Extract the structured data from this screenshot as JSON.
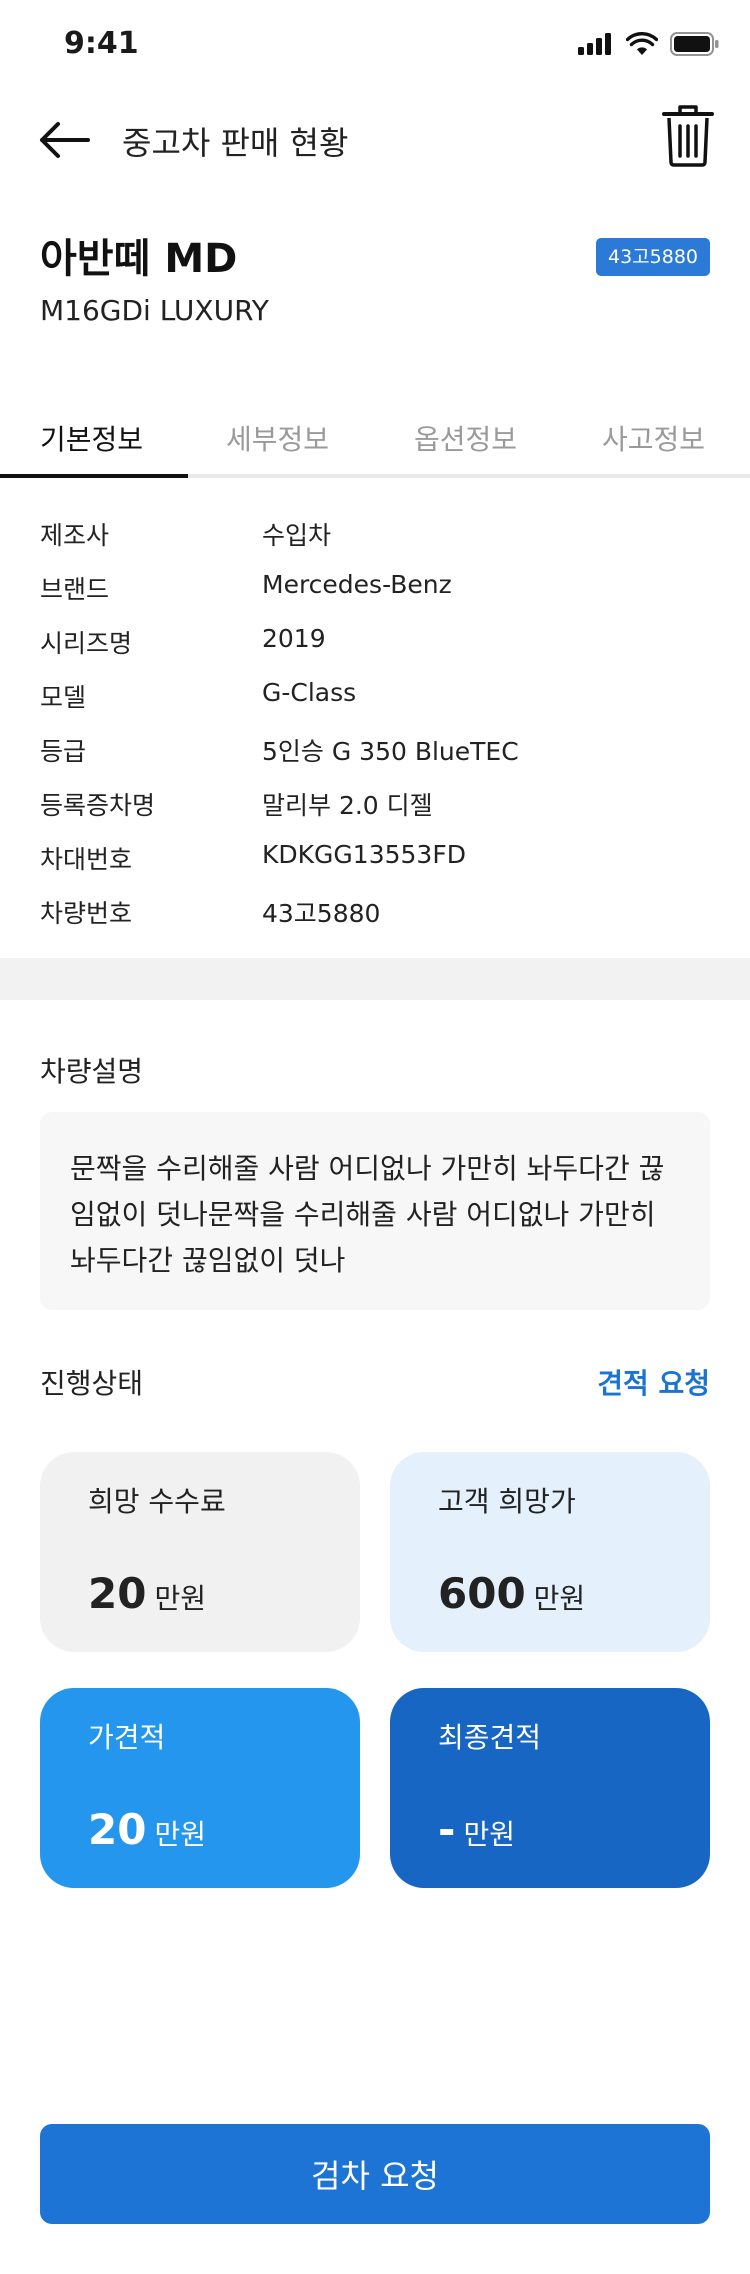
{
  "status": {
    "time": "9:41"
  },
  "header": {
    "title": "중고차 판매 현황"
  },
  "car": {
    "name": "아반떼 MD",
    "trim": "M16GDi LUXURY",
    "plate": "43고5880"
  },
  "tabs": [
    {
      "label": "기본정보",
      "active": true
    },
    {
      "label": "세부정보",
      "active": false
    },
    {
      "label": "옵션정보",
      "active": false
    },
    {
      "label": "사고정보",
      "active": false
    }
  ],
  "info": [
    {
      "key": "제조사",
      "value": "수입차"
    },
    {
      "key": "브랜드",
      "value": "Mercedes-Benz"
    },
    {
      "key": "시리즈명",
      "value": "2019"
    },
    {
      "key": "모델",
      "value": "G-Class"
    },
    {
      "key": "등급",
      "value": "5인승 G 350 BlueTEC"
    },
    {
      "key": "등록증차명",
      "value": "말리부 2.0 디젤"
    },
    {
      "key": "차대번호",
      "value": "KDKGG13553FD"
    },
    {
      "key": "차량번호",
      "value": "43고5880"
    }
  ],
  "description": {
    "label": "차량설명",
    "text": "문짝을 수리해줄 사람 어디없나 가만히 놔두다간 끊임없이 덧나문짝을 수리해줄 사람 어디없나 가만히 놔두다간 끊임없이 덧나"
  },
  "progress": {
    "label": "진행상태",
    "estimate_link": "견적 요청",
    "cards": {
      "fee": {
        "label": "희망 수수료",
        "amount": "20",
        "unit": "만원"
      },
      "hope": {
        "label": "고객 희망가",
        "amount": "600",
        "unit": "만원"
      },
      "pre": {
        "label": "가견적",
        "amount": "20",
        "unit": "만원"
      },
      "final": {
        "label": "최종견적",
        "amount": "-",
        "unit": "만원"
      }
    }
  },
  "actions": {
    "inspect_label": "검차 요청"
  },
  "colors": {
    "accent": "#1d74d4",
    "badge": "#2b7ad8",
    "card_pre": "#2496ee",
    "card_final": "#1766c3",
    "card_hope": "#e4f0fc",
    "card_fee": "#f1f1f1"
  }
}
